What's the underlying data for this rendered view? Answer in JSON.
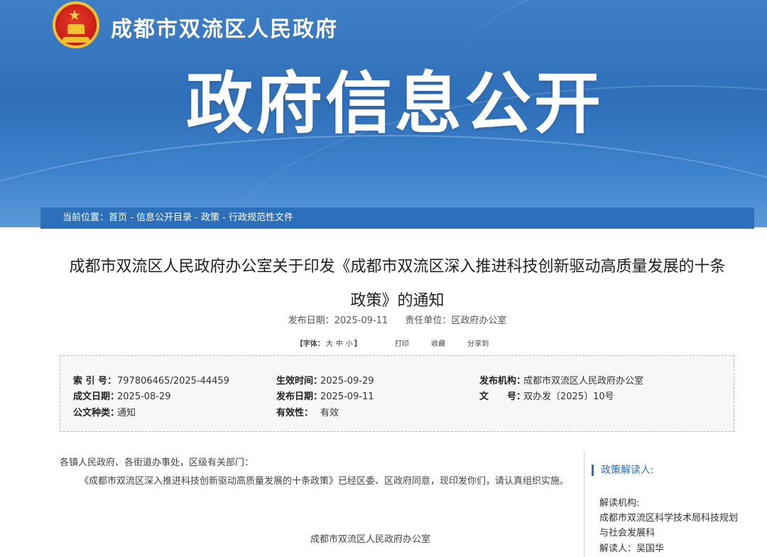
{
  "header": {
    "site_name": "成都市双流区人民政府",
    "banner_title": "政府信息公开",
    "emblem": "national-emblem-icon"
  },
  "breadcrumb": {
    "prefix": "当前位置：",
    "items": [
      "首页",
      "信息公开目录",
      "政策",
      "行政规范性文件"
    ],
    "separator": " - "
  },
  "document": {
    "title_line1": "成都市双流区人民政府办公室关于印发《成都市双流区深入推进科技创新驱动高质量发展的十条",
    "title_line2": "政策》的通知",
    "publish_date_label": "发布日期：",
    "publish_date": "2025-09-11",
    "unit_label": "责任单位：",
    "unit": "区政府办公室"
  },
  "tools": {
    "font_size_label": "【字体：",
    "sizes": [
      "大",
      "中",
      "小"
    ],
    "font_size_close": "】",
    "print": "打印",
    "favorite": "收藏",
    "share": "分享到"
  },
  "info": {
    "index_label": "索 引 号：",
    "index_value": "797806465/2025-44459",
    "effective_label": "生效时间：",
    "effective_value": "2025-09-29",
    "org_label": "发布机构：",
    "org_value": "成都市双流区人民政府办公室",
    "written_label": "成文日期：",
    "written_value": "2025-08-29",
    "pub_label": "发布日期：",
    "pub_value": "2025-09-11",
    "docno_label": "文　　号：",
    "docno_value": "双办发〔2025〕10号",
    "type_label": "公文种类：",
    "type_value": "通知",
    "validity_label": "有效性：",
    "validity_value": "有效"
  },
  "body": {
    "salutation": "各镇人民政府、各街道办事处，区级有关部门：",
    "paragraph": "《成都市双流区深入推进科技创新驱动高质量发展的十条政策》已经区委、区政府同意，现印发你们，请认真组织实施。",
    "signature": "成都市双流区人民政府办公室"
  },
  "sidebar": {
    "heading": "政策解读人:",
    "org_label": "解读机构:",
    "org_value": "成都市双流区科学技术局科技规划与社会发展科",
    "reader": "解读人：吴国华"
  },
  "colors": {
    "banner": "#2f6fb9",
    "crumb_bar": "#2c6fba",
    "accent": "#2c6fba"
  }
}
